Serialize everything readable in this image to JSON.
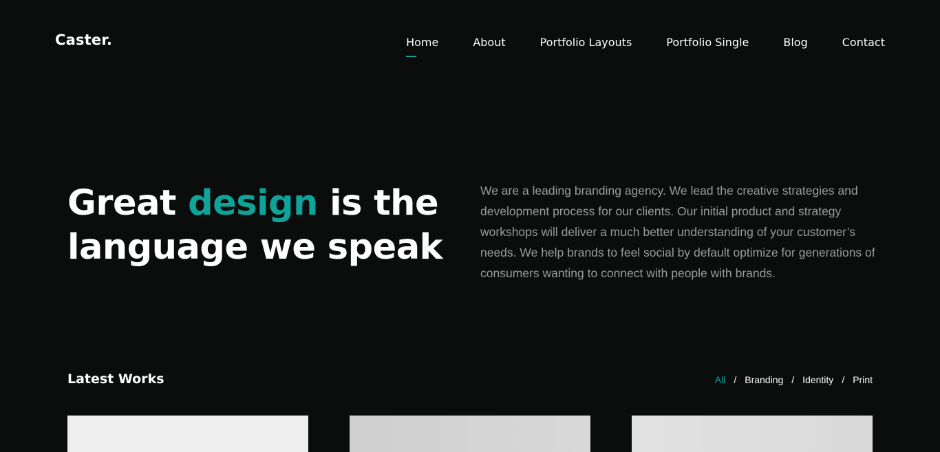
{
  "colors": {
    "accent": "#0fa39a",
    "background": "#0b0c0c",
    "muted_text": "#9a9c9c"
  },
  "header": {
    "logo": "Caster.",
    "nav": [
      {
        "label": "Home",
        "active": true
      },
      {
        "label": "About",
        "active": false
      },
      {
        "label": "Portfolio Layouts",
        "active": false
      },
      {
        "label": "Portfolio Single",
        "active": false
      },
      {
        "label": "Blog",
        "active": false
      },
      {
        "label": "Contact",
        "active": false
      }
    ]
  },
  "hero": {
    "title_part1": "Great ",
    "title_accent": "design",
    "title_part2": " is the language we speak",
    "description": "We are a leading branding agency. We lead the creative strategies and development process for our clients. Our initial product and strategy workshops will deliver a much better understanding of your customer’s needs. We help brands to feel social by default optimize for generations of consumers wanting to connect with people with brands."
  },
  "works": {
    "title": "Latest Works",
    "filters": [
      {
        "label": "All",
        "active": true
      },
      {
        "label": "Branding",
        "active": false
      },
      {
        "label": "Identity",
        "active": false
      },
      {
        "label": "Print",
        "active": false
      }
    ],
    "separator": "/"
  }
}
